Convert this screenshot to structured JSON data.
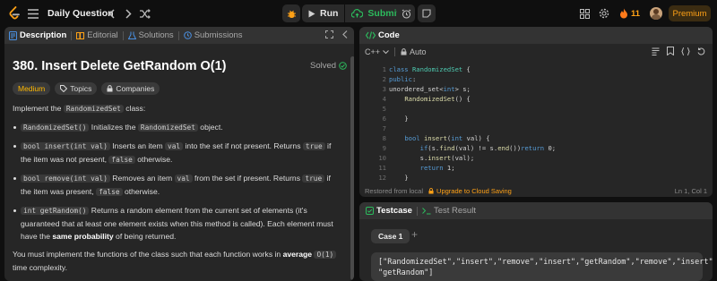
{
  "topbar": {
    "title": "Daily Question",
    "run_label": "Run",
    "submit_label": "Submit",
    "streak_count": "11",
    "premium_label": "Premium"
  },
  "left": {
    "tabs": [
      "Description",
      "Editorial",
      "Solutions",
      "Submissions"
    ],
    "title": "380. Insert Delete GetRandom O(1)",
    "solved": "Solved",
    "difficulty": "Medium",
    "topics": "Topics",
    "companies": "Companies",
    "intro_pre": "Implement the ",
    "intro_code": "RandomizedSet",
    "intro_post": " class:",
    "items": [
      {
        "code": "RandomizedSet()",
        "text_a": " Initializes the ",
        "code2": "RandomizedSet",
        "text_b": " object."
      },
      {
        "code": "bool insert(int val)",
        "text_a": " Inserts an item ",
        "code2": "val",
        "text_b": " into the set if not present. Returns ",
        "code3": "true",
        "text_c": " if the item was not present, ",
        "code4": "false",
        "text_d": " otherwise."
      },
      {
        "code": "bool remove(int val)",
        "text_a": " Removes an item ",
        "code2": "val",
        "text_b": " from the set if present. Returns ",
        "code3": "true",
        "text_c": " if the item was present, ",
        "code4": "false",
        "text_d": " otherwise."
      },
      {
        "code": "int getRandom()",
        "text_a": " Returns a random element from the current set of elements (it's guaranteed that at least one element exists when this method is called). Each element must have the ",
        "bold": "same probability",
        "text_b": " of being returned."
      }
    ],
    "outro_pre": "You must implement the functions of the class such that each function works in ",
    "outro_bold": "average",
    "outro_code": "O(1)",
    "outro_post": " time complexity."
  },
  "code_panel": {
    "header": "Code",
    "language": "C++",
    "mode": "Auto",
    "line_numbers": [
      "1",
      "2",
      "3",
      "4",
      "5",
      "6",
      "7",
      "8",
      "9",
      "10",
      "11",
      "12"
    ],
    "status_left": "Restored from local",
    "upgrade": "Upgrade to Cloud Saving",
    "position": "Ln 1, Col 1"
  },
  "testcase": {
    "tab1": "Testcase",
    "tab2": "Test Result",
    "case_label": "Case 1",
    "input_line1": "[\"RandomizedSet\",\"insert\",\"remove\",\"insert\",\"getRandom\",\"remove\",\"insert\",",
    "input_line2": "\"getRandom\"]"
  },
  "colors": {
    "accent": "#ffa116",
    "success": "#2cbb5d",
    "medium": "#ffb800"
  }
}
